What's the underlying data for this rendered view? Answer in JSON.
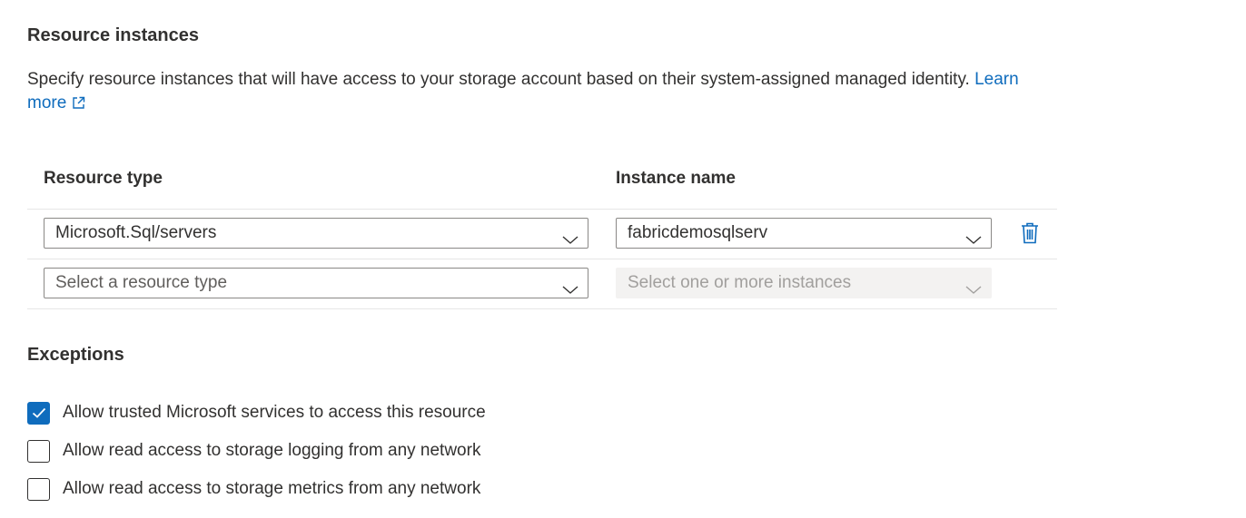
{
  "resource_instances": {
    "title": "Resource instances",
    "description": "Specify resource instances that will have access to your storage account based on their system-assigned managed identity.",
    "learn_more_line1": "Learn",
    "learn_more_line2": "more",
    "columns": {
      "resource_type": "Resource type",
      "instance_name": "Instance name"
    },
    "rows": [
      {
        "resource_type": "Microsoft.Sql/servers",
        "instance_name": "fabricdemosqlserv"
      },
      {
        "resource_type": "Select a resource type",
        "instance_name": "Select one or more instances"
      }
    ]
  },
  "exceptions": {
    "title": "Exceptions",
    "items": [
      {
        "label": "Allow trusted Microsoft services to access this resource",
        "checked": true
      },
      {
        "label": "Allow read access to storage logging from any network",
        "checked": false
      },
      {
        "label": "Allow read access to storage metrics from any network",
        "checked": false
      }
    ]
  },
  "colors": {
    "accent": "#0f6cbd",
    "text": "#323130",
    "disabled_bg": "#f3f2f1"
  }
}
